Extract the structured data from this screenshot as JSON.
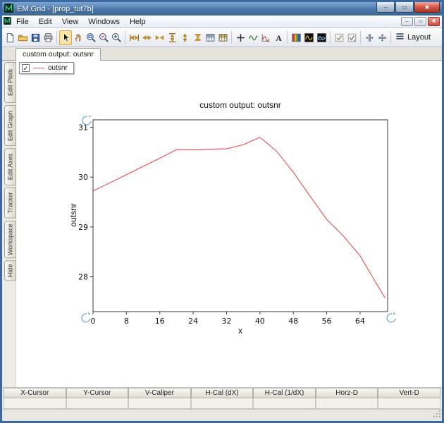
{
  "window": {
    "title": "EM.Grid - [prop_tut7b]",
    "controls": {
      "minimize": "–",
      "restore": "▭",
      "close": "✖"
    }
  },
  "menu": {
    "items": [
      "File",
      "Edit",
      "View",
      "Windows",
      "Help"
    ]
  },
  "toolbar": {
    "layout_label": "Layout",
    "buttons": [
      {
        "name": "new",
        "kind": "page"
      },
      {
        "name": "open",
        "kind": "folder"
      },
      {
        "name": "save",
        "kind": "floppy"
      },
      {
        "name": "print",
        "kind": "printer"
      },
      {
        "kind": "sep"
      },
      {
        "name": "select",
        "kind": "cursor",
        "selected": true
      },
      {
        "name": "pan",
        "kind": "hand"
      },
      {
        "name": "zoom-window",
        "kind": "zoomwin"
      },
      {
        "name": "zoom-out",
        "kind": "zoomout"
      },
      {
        "name": "zoom-in",
        "kind": "zoomin"
      },
      {
        "kind": "sep"
      },
      {
        "name": "fit-horizontal",
        "kind": "fith"
      },
      {
        "name": "expand-horizontal",
        "kind": "exph"
      },
      {
        "name": "shrink-horizontal",
        "kind": "shrh"
      },
      {
        "name": "fit-vertical",
        "kind": "fitv"
      },
      {
        "name": "expand-vertical",
        "kind": "expv"
      },
      {
        "name": "sum",
        "kind": "sigma"
      },
      {
        "name": "data-table",
        "kind": "table"
      },
      {
        "name": "data-table-2",
        "kind": "table2"
      },
      {
        "kind": "sep"
      },
      {
        "name": "crosshair",
        "kind": "plus"
      },
      {
        "name": "trace",
        "kind": "sine"
      },
      {
        "name": "plot-curve",
        "kind": "sine2"
      },
      {
        "name": "text-annotation",
        "kind": "letterA"
      },
      {
        "kind": "sep"
      },
      {
        "name": "colormap",
        "kind": "colormap"
      },
      {
        "name": "waveform-dark",
        "kind": "blackwave"
      },
      {
        "name": "waveform-dark-2",
        "kind": "blackwave2"
      },
      {
        "kind": "sep"
      },
      {
        "name": "option-toggle",
        "kind": "check1"
      },
      {
        "name": "option-toggle-2",
        "kind": "check2"
      },
      {
        "kind": "sep"
      },
      {
        "name": "split-horizontal",
        "kind": "splith"
      },
      {
        "name": "split-vertical",
        "kind": "splitv"
      },
      {
        "kind": "sep"
      }
    ]
  },
  "tab": {
    "label": "custom output: outsnr"
  },
  "legend": {
    "label": "outsnr",
    "checked": true,
    "check_glyph": "✓",
    "line_color": "#e95b5b"
  },
  "side_tabs": [
    "Edit Plots",
    "Edit Graph",
    "Edit Axes",
    "Tracker",
    "Workspace",
    "Hide"
  ],
  "chart_data": {
    "type": "line",
    "title": "custom output: outsnr",
    "xlabel": "x",
    "ylabel": "outsnr",
    "xlim": [
      0,
      70.6
    ],
    "ylim": [
      27.3,
      31.15
    ],
    "xticks": [
      0,
      8,
      16,
      24,
      32,
      40,
      48,
      56,
      64
    ],
    "yticks": [
      28,
      29,
      30,
      31
    ],
    "grid": false,
    "legend_position": "top-left",
    "series": [
      {
        "name": "outsnr",
        "color": "#e95b5b",
        "points": [
          [
            0,
            29.72
          ],
          [
            8,
            30.05
          ],
          [
            16,
            30.38
          ],
          [
            20,
            30.55
          ],
          [
            26,
            30.55
          ],
          [
            32,
            30.57
          ],
          [
            36,
            30.65
          ],
          [
            40,
            30.8
          ],
          [
            44,
            30.52
          ],
          [
            48,
            30.1
          ],
          [
            52,
            29.62
          ],
          [
            56,
            29.15
          ],
          [
            60,
            28.82
          ],
          [
            64,
            28.42
          ],
          [
            70,
            27.57
          ]
        ]
      }
    ]
  },
  "bottom_table": {
    "headers": [
      "X-Cursor",
      "Y-Cursor",
      "V-Caliper",
      "H-Cal (dX)",
      "H-Cal (1/dX)",
      "Horz-D",
      "Vert-D"
    ],
    "values": [
      "",
      "",
      "",
      "",
      "",
      "",
      ""
    ]
  }
}
